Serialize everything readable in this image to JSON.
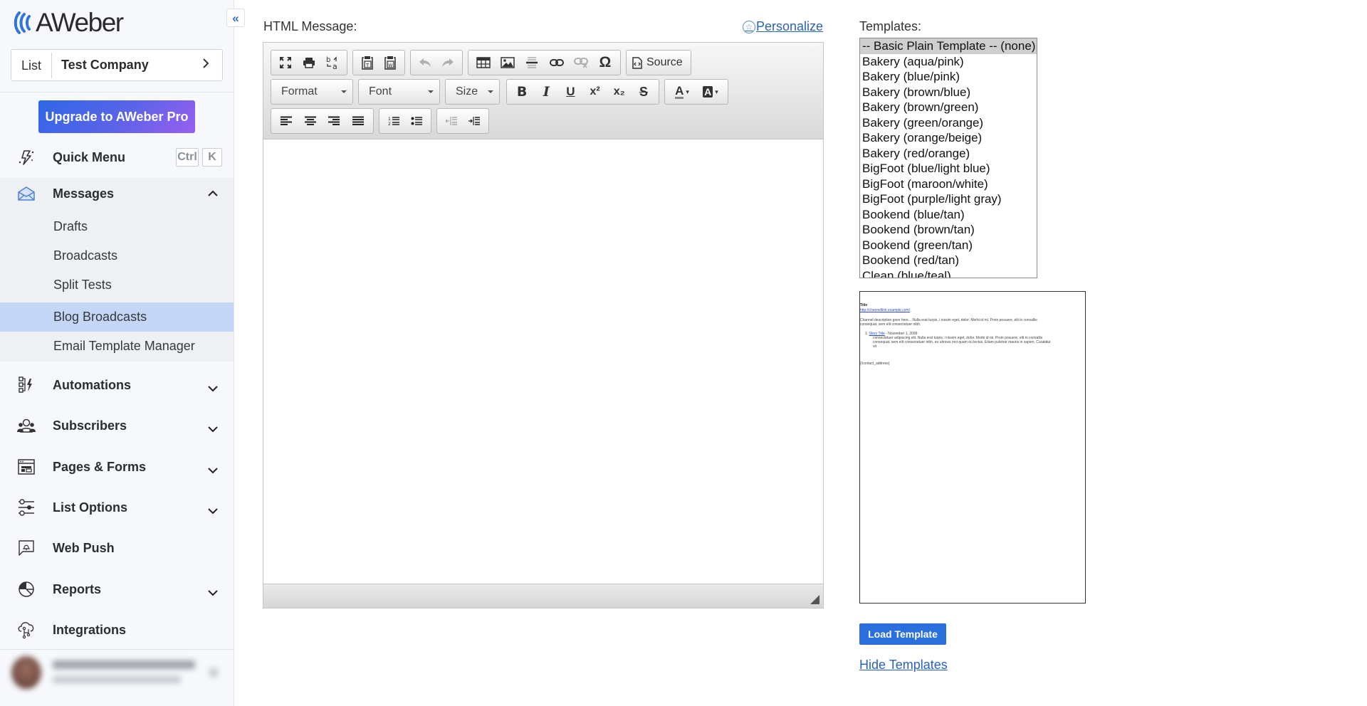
{
  "app": {
    "logo_text": "AWeber",
    "collapse_icon": "double-chevron-left-icon"
  },
  "sidebar": {
    "list_selector": {
      "label": "List",
      "value": "Test Company"
    },
    "upgrade_button": "Upgrade to AWeber Pro",
    "quick_menu": {
      "label": "Quick Menu",
      "shortcut": [
        "Ctrl",
        "K"
      ]
    },
    "messages": {
      "label": "Messages",
      "expanded": true,
      "children": [
        {
          "label": "Drafts",
          "active": false
        },
        {
          "label": "Broadcasts",
          "active": false
        },
        {
          "label": "Split Tests",
          "active": false
        },
        {
          "label": "Blog Broadcasts",
          "active": true
        },
        {
          "label": "Email Template Manager",
          "active": false
        }
      ]
    },
    "items": [
      {
        "label": "Automations",
        "icon": "automations-icon",
        "has_chevron": true
      },
      {
        "label": "Subscribers",
        "icon": "subscribers-icon",
        "has_chevron": true
      },
      {
        "label": "Pages & Forms",
        "icon": "pages-forms-icon",
        "has_chevron": true
      },
      {
        "label": "List Options",
        "icon": "sliders-icon",
        "has_chevron": true
      },
      {
        "label": "Web Push",
        "icon": "web-push-icon",
        "has_chevron": false
      },
      {
        "label": "Reports",
        "icon": "pie-chart-icon",
        "has_chevron": true
      },
      {
        "label": "Integrations",
        "icon": "cloud-integrations-icon",
        "has_chevron": false
      }
    ]
  },
  "editor": {
    "label": "HTML Message:",
    "personalize_link": "Personalize",
    "toolbar": {
      "row1": [
        "maximize",
        "print",
        "find-replace",
        "paste-as-text",
        "paste-from-word",
        "undo",
        "redo",
        "table",
        "image",
        "horizontal-line",
        "link",
        "unlink",
        "special-character"
      ],
      "source_label": "Source",
      "format_combo": "Format",
      "font_combo": "Font",
      "size_combo": "Size",
      "bold": "B",
      "italic": "I",
      "underline": "U",
      "superscript": "x²",
      "subscript": "x₂",
      "strikethrough": "S",
      "text_color": "A",
      "bg_color": "A",
      "special_char": "Ω"
    },
    "content": ""
  },
  "templates": {
    "label": "Templates:",
    "options": [
      "-- Basic Plain Template -- (none)",
      "Bakery (aqua/pink)",
      "Bakery (blue/pink)",
      "Bakery (brown/blue)",
      "Bakery (brown/green)",
      "Bakery (green/orange)",
      "Bakery (orange/beige)",
      "Bakery (red/orange)",
      "BigFoot (blue/light blue)",
      "BigFoot (maroon/white)",
      "BigFoot (purple/light gray)",
      "Bookend (blue/tan)",
      "Bookend (brown/tan)",
      "Bookend (green/tan)",
      "Bookend (red/tan)",
      "Clean (blue/teal)"
    ],
    "selected": "-- Basic Plain Template -- (none)",
    "preview": {
      "title": "Title",
      "link": "http://channellink.example.com/",
      "description": "Channel description goes here... Nulla erat turpis, i nissim eget, dolor. Morbi id mi. Proin posuere, elit in convallis",
      "description2": "consequat, sem elit consectetuer nibh.",
      "story_number": "1.",
      "story_title": "Story Title",
      "story_date": " - November 1, 2099",
      "story_body1": "consectetuer adipiscing elit. Nulla erat turpis, i nissim eget, dolor. Morbi id mi. Proin posuere, elit in convallis",
      "story_body2": "consequat, sem elit consectetuer nibh, eu ultrices orci quam eu lectus. Etiam pulvinar mauris in sapien. Curabitur",
      "story_body3": "sit",
      "footer": "{!contact_address}"
    },
    "load_button": "Load Template",
    "hide_link": "Hide Templates"
  },
  "colors": {
    "accent": "#2a6fdb",
    "link": "#2a62b7",
    "active_nav": "#c4d7f7",
    "sidebar_bg": "#f6f8fc"
  }
}
